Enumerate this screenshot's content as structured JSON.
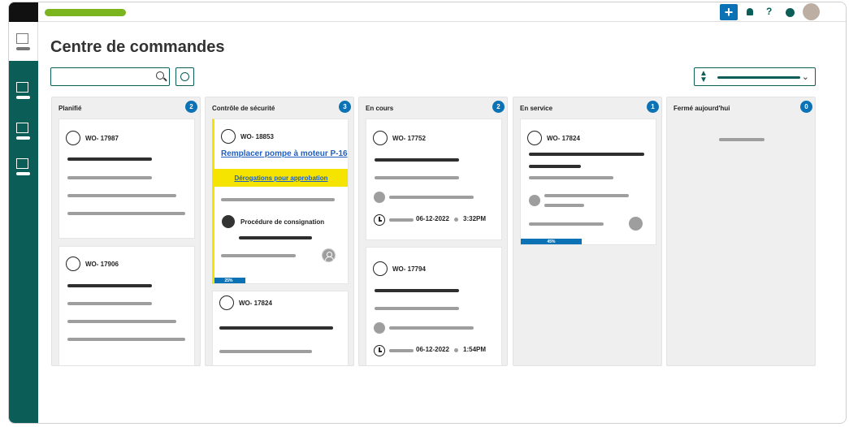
{
  "header": {
    "title": "Centre de commandes",
    "help_label": "?",
    "add_label": "+"
  },
  "columns": [
    {
      "title": "Planifié",
      "count": "2",
      "cards": [
        {
          "wo": "WO- 17987"
        },
        {
          "wo": "WO- 17906"
        }
      ]
    },
    {
      "title": "Contrôle de sécurité",
      "count": "3",
      "cards": [
        {
          "wo": "WO- 18853",
          "link": "Remplacer pompe à moteur P-16",
          "approval": "Dérogations pour approbation",
          "procedure": "Procédure de consignation",
          "progress": "25%",
          "progress_value": 25
        },
        {
          "wo": "WO- 17824"
        }
      ]
    },
    {
      "title": "En cours",
      "count": "2",
      "cards": [
        {
          "wo": "WO- 17752",
          "date": "06-12-2022",
          "time": "3:32PM"
        },
        {
          "wo": "WO- 17794",
          "date": "06-12-2022",
          "time": "1:54PM"
        }
      ]
    },
    {
      "title": "En service",
      "count": "1",
      "cards": [
        {
          "wo": "WO- 17824",
          "progress": "45%",
          "progress_value": 45
        }
      ]
    },
    {
      "title": "Fermé aujourd'hui",
      "count": "0",
      "cards": []
    }
  ],
  "colors": {
    "accent": "#0a5e57",
    "badge": "#0a72b5",
    "highlight": "#f5e400",
    "brand": "#7ab51d"
  },
  "icons": [
    "plus-icon",
    "bell-icon",
    "help-icon",
    "status-dot-icon",
    "avatar",
    "search-icon",
    "filter-icon",
    "sort-icon",
    "chevron-down-icon",
    "clock-icon",
    "user-icon"
  ]
}
